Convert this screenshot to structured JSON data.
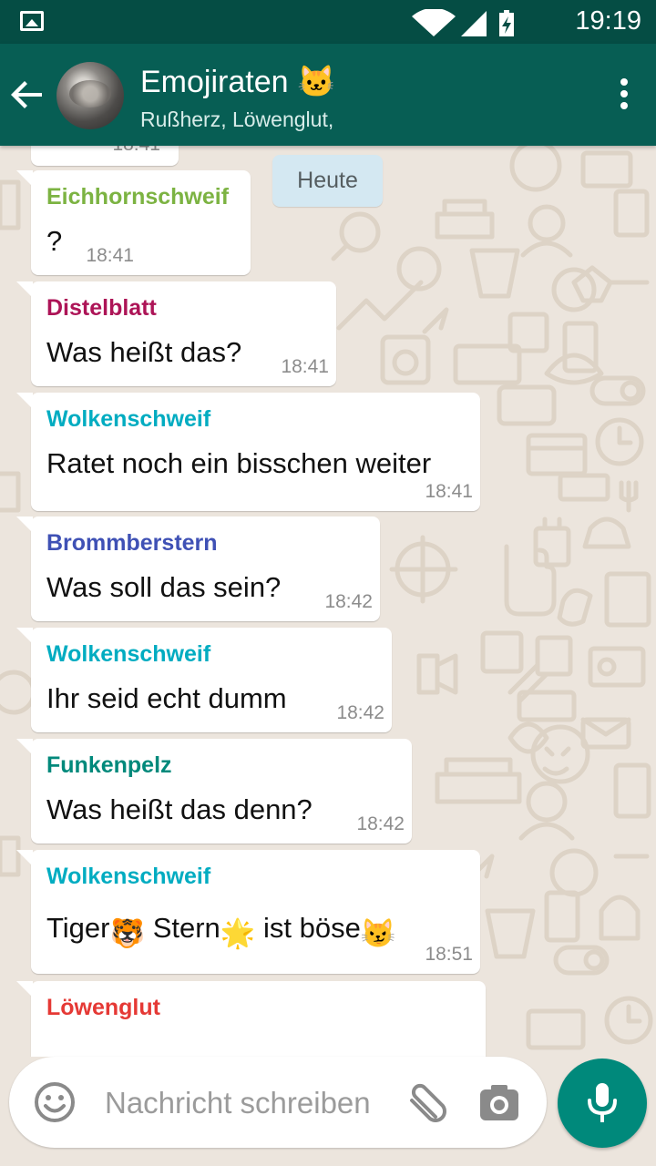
{
  "status_bar": {
    "time": "19:19",
    "icons": [
      "image-icon",
      "wifi-icon",
      "signal-icon",
      "battery-charging-icon"
    ]
  },
  "header": {
    "back_icon": "arrow-back-icon",
    "title": "Emojiraten 🐱",
    "subtitle": "Rußherz, Löwenglut,",
    "menu_icon": "more-vert-icon"
  },
  "chat": {
    "partial_top_time": "18:41",
    "date_chip": "Heute",
    "messages": [
      {
        "sender": "Eichhornschweif",
        "color": "#7cb342",
        "text": "?",
        "time": "18:41"
      },
      {
        "sender": "Distelblatt",
        "color": "#ad1457",
        "text": "Was heißt das?",
        "time": "18:41"
      },
      {
        "sender": "Wolkenschweif",
        "color": "#00acc1",
        "text": "Ratet noch ein bisschen weiter",
        "time": "18:41"
      },
      {
        "sender": "Brommberstern",
        "color": "#3f51b5",
        "text": "Was soll das sein?",
        "time": "18:42"
      },
      {
        "sender": "Wolkenschweif",
        "color": "#00acc1",
        "text": "Ihr seid echt dumm",
        "time": "18:42"
      },
      {
        "sender": "Funkenpelz",
        "color": "#00897b",
        "text": "Was heißt das denn?",
        "time": "18:42"
      },
      {
        "sender": "Wolkenschweif",
        "color": "#00acc1",
        "text_parts": [
          "Tiger",
          "🐯",
          " Stern",
          "🌟",
          " ist böse",
          "😼"
        ],
        "time": "18:51"
      },
      {
        "sender": "Löwenglut",
        "color": "#e53935",
        "text": "",
        "time": ""
      }
    ]
  },
  "composer": {
    "placeholder": "Nachricht schreiben",
    "emoji_icon": "smiley-icon",
    "attach_icon": "paperclip-icon",
    "camera_icon": "camera-icon",
    "mic_icon": "microphone-icon"
  },
  "colors": {
    "header": "#075e54",
    "status_bar": "#054d44",
    "wallpaper": "#ece5dd",
    "date_chip": "#d4e8f2",
    "mic_button": "#00897b"
  }
}
